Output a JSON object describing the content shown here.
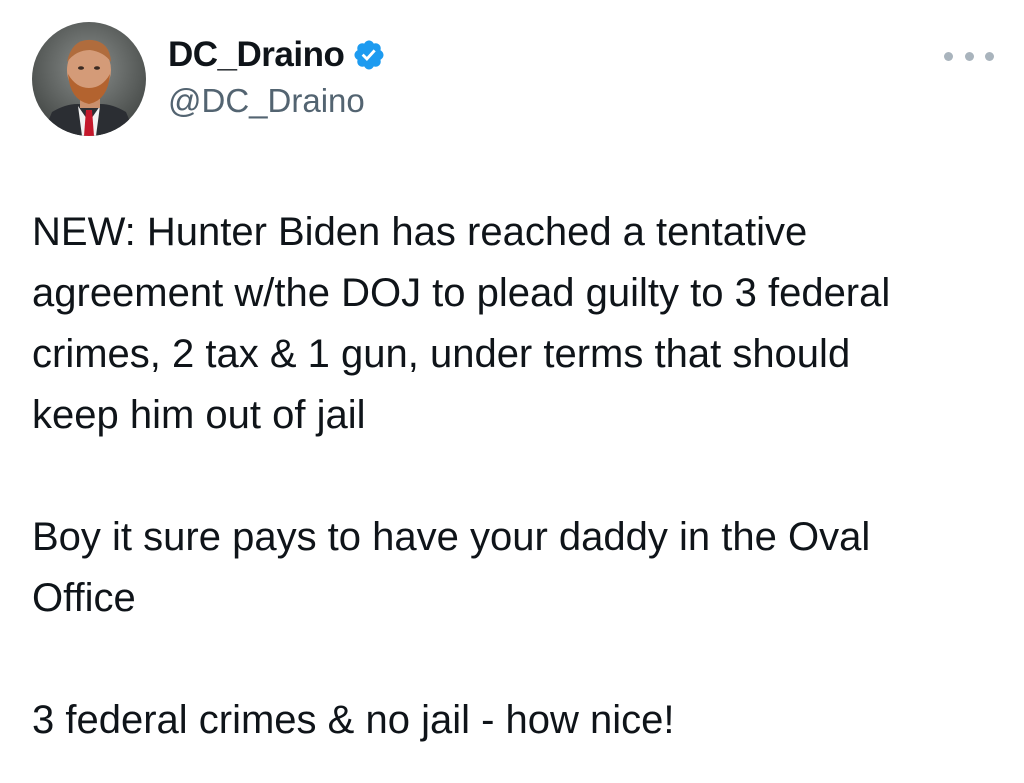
{
  "author": {
    "display_name": "DC_Draino",
    "handle": "@DC_Draino",
    "verified": true,
    "verified_color": "#1d9bf0"
  },
  "tweet": {
    "lines": [
      "NEW: Hunter Biden has reached a tentative",
      "agreement w/the DOJ to plead guilty to 3 federal",
      "crimes, 2 tax & 1 gun, under terms that should",
      "keep him out of jail",
      "Boy it sure pays to have your daddy in the Oval",
      "Office",
      "3 federal crimes & no jail - how nice!"
    ]
  },
  "icons": {
    "avatar": "profile-photo",
    "verified": "verified-badge-icon",
    "more": "more-options-icon"
  }
}
